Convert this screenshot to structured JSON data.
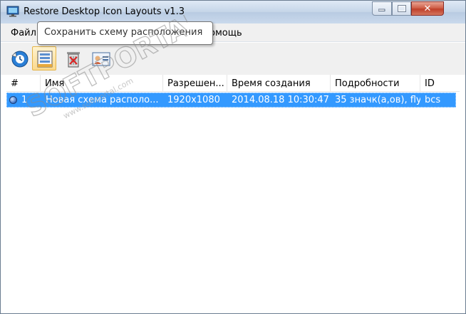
{
  "window": {
    "title": "Restore Desktop Icon Layouts v1.3"
  },
  "menu": {
    "file": "Файл",
    "help": "омощь"
  },
  "toolbar": {
    "buttons": [
      {
        "icon": "restore-layout-icon"
      },
      {
        "icon": "save-layout-icon"
      },
      {
        "icon": "delete-layout-icon"
      },
      {
        "icon": "properties-icon"
      }
    ]
  },
  "tooltip": "Сохранить схему расположения",
  "table": {
    "columns": [
      "#",
      "Имя",
      "Разрешен...",
      "Время создания",
      "Подробности",
      "ID"
    ],
    "rows": [
      {
        "num": "1",
        "name": "Новая схема располо...",
        "resolution": "1920x1080",
        "created": "2014.08.18 10:30:47",
        "details": "35 значк(а,ов), fly",
        "id": "bcs"
      }
    ]
  },
  "watermark": {
    "text": "SOFTPORTAL",
    "url": "www.softportal.com"
  },
  "colors": {
    "selection": "#3399ff",
    "titlebar": "#c9d9ec",
    "close": "#c0402a"
  }
}
